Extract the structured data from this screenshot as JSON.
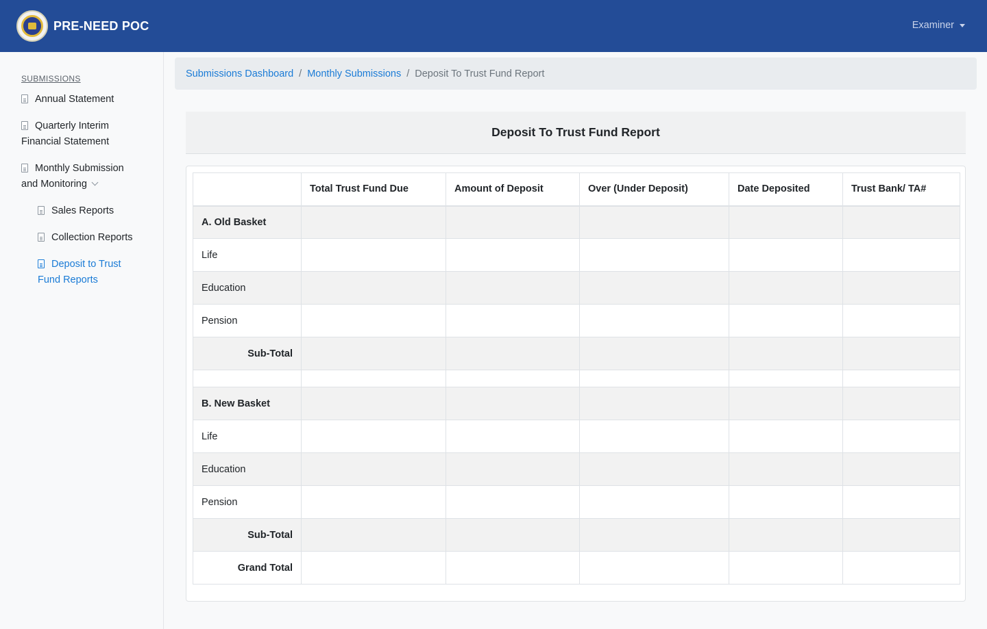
{
  "header": {
    "app_title": "PRE-NEED POC",
    "user_menu_label": "Examiner"
  },
  "sidebar": {
    "heading": "SUBMISSIONS",
    "items": [
      {
        "line1": "Annual Statement"
      },
      {
        "line1": "Quarterly Interim",
        "line2": "Financial Statement"
      },
      {
        "line1": "Monthly Submission",
        "line2": "and Monitoring"
      },
      {
        "line1": "Sales Reports"
      },
      {
        "line1": "Collection Reports"
      },
      {
        "line1": "Deposit to Trust",
        "line2": "Fund Reports"
      }
    ]
  },
  "breadcrumb": {
    "items": [
      "Submissions Dashboard",
      "Monthly Submissions"
    ],
    "current": "Deposit To Trust Fund Report",
    "separator": "/"
  },
  "report": {
    "title": "Deposit To Trust Fund Report",
    "columns": [
      "",
      "Total Trust Fund Due",
      "Amount of Deposit",
      "Over (Under Deposit)",
      "Date Deposited",
      "Trust Bank/ TA#"
    ],
    "rows": [
      {
        "label": "A. Old Basket",
        "bold": true
      },
      {
        "label": "Life"
      },
      {
        "label": "Education"
      },
      {
        "label": "Pension"
      },
      {
        "label": "Sub-Total",
        "bold": true,
        "right": true
      },
      {
        "label": "",
        "spacer": true
      },
      {
        "label": "B. New Basket",
        "bold": true
      },
      {
        "label": "Life"
      },
      {
        "label": "Education"
      },
      {
        "label": "Pension"
      },
      {
        "label": "Sub-Total",
        "bold": true,
        "right": true
      },
      {
        "label": "Grand Total",
        "bold": true,
        "right": true
      }
    ]
  },
  "colors": {
    "navbar": "#234c97",
    "link": "#1a7bd6",
    "stripe": "#f2f2f2"
  }
}
